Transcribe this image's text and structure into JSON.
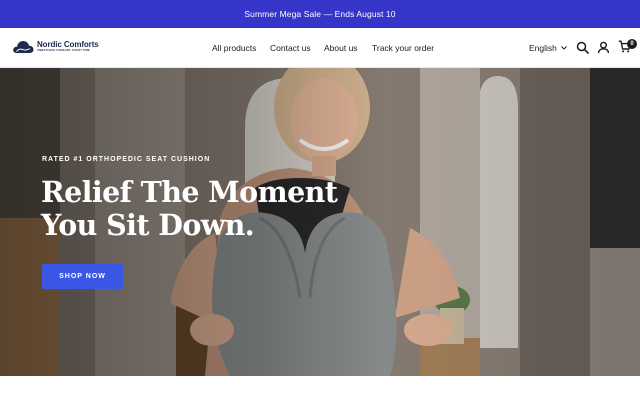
{
  "announcement": {
    "text": "Summer Mega Sale — Ends August 10"
  },
  "header": {
    "logo": {
      "name": "Nordic Comforts",
      "tagline": "UNMATCHED COMFORT, EVERY TIME"
    },
    "nav": {
      "all_products": "All products",
      "contact_us": "Contact us",
      "about_us": "About us",
      "track_order": "Track your order"
    },
    "language": "English",
    "cart_count": "0",
    "icons": [
      "cloud-logo-icon",
      "chevron-down-icon",
      "search-icon",
      "account-icon",
      "cart-icon"
    ]
  },
  "hero": {
    "eyebrow": "RATED #1 ORTHOPEDIC SEAT CUSHION",
    "headline": "Relief The Moment You Sit Down.",
    "cta_label": "SHOP NOW"
  },
  "colors": {
    "announcement_bg": "#3535c9",
    "cta_bg": "#3b57e6",
    "logo_navy": "#1e2b4d",
    "header_bg": "#ffffff"
  }
}
